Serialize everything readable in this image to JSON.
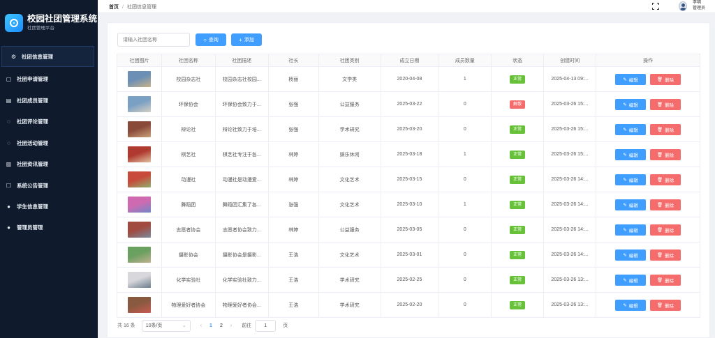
{
  "app": {
    "title": "校园社团管理系统",
    "subtitle": "社团管理平台"
  },
  "sidebar": {
    "items": [
      {
        "label": "社团信息管理",
        "icon": "gear-icon",
        "active": true
      },
      {
        "label": "社团申请管理",
        "icon": "document-icon"
      },
      {
        "label": "社团成员管理",
        "icon": "notebook-icon"
      },
      {
        "label": "社团评论管理",
        "icon": "chat-bubble-icon"
      },
      {
        "label": "社团活动管理",
        "icon": "chat-bubble-icon"
      },
      {
        "label": "社团资讯管理",
        "icon": "tickets-icon"
      },
      {
        "label": "系统公告管理",
        "icon": "edit-note-icon"
      },
      {
        "label": "学生信息管理",
        "icon": "user-icon"
      },
      {
        "label": "管理员管理",
        "icon": "user-icon"
      }
    ]
  },
  "header": {
    "breadcrumb_home": "首页",
    "breadcrumb_sep": "/",
    "breadcrumb_current": "社团信息管理",
    "user_name": "李明",
    "user_role": "管理员"
  },
  "toolbar": {
    "search_placeholder": "请输入社团名称",
    "search_label": "查询",
    "add_label": "添加"
  },
  "table": {
    "columns": [
      "社团图片",
      "社团名称",
      "社团描述",
      "社长",
      "社团类别",
      "成立日期",
      "成员数量",
      "状态",
      "创建时间",
      "操作"
    ],
    "edit_label": "编辑",
    "delete_label": "删除",
    "rows": [
      {
        "name": "校园杂志社",
        "desc": "校园杂志社校园...",
        "leader": "杨丽",
        "category": "文学类",
        "date": "2020-04-08",
        "members": "1",
        "status": "正常",
        "status_color": "#67c23a",
        "created": "2025-04-13 09:...",
        "img": [
          "#6b8fb5",
          "#c9b28a"
        ]
      },
      {
        "name": "环保协会",
        "desc": "环保协会致力于...",
        "leader": "张强",
        "category": "公益服务",
        "date": "2025-03-22",
        "members": "0",
        "status": "解散",
        "status_color": "#f56c6c",
        "created": "2025-03-26 15:...",
        "img": [
          "#7aa0c4",
          "#d4d0c4"
        ]
      },
      {
        "name": "辩论社",
        "desc": "辩论社致力于培...",
        "leader": "张强",
        "category": "学术研究",
        "date": "2025-03-20",
        "members": "0",
        "status": "正常",
        "status_color": "#67c23a",
        "created": "2025-03-26 15:...",
        "img": [
          "#8a4a3a",
          "#caa27a"
        ]
      },
      {
        "name": "棋艺社",
        "desc": "棋艺社专注于各...",
        "leader": "林婷",
        "category": "娱乐休闲",
        "date": "2025-03-18",
        "members": "1",
        "status": "正常",
        "status_color": "#67c23a",
        "created": "2025-03-26 15:...",
        "img": [
          "#b03a30",
          "#e0c0a0"
        ]
      },
      {
        "name": "动漫社",
        "desc": "动漫社是动漫爱...",
        "leader": "林婷",
        "category": "文化艺术",
        "date": "2025-03-15",
        "members": "0",
        "status": "正常",
        "status_color": "#67c23a",
        "created": "2025-03-26 14:...",
        "img": [
          "#c84a3a",
          "#8fb070"
        ]
      },
      {
        "name": "舞蹈团",
        "desc": "舞蹈团汇集了各...",
        "leader": "张强",
        "category": "文化艺术",
        "date": "2025-03-10",
        "members": "1",
        "status": "正常",
        "status_color": "#67c23a",
        "created": "2025-03-26 14:...",
        "img": [
          "#d06ab0",
          "#7088c8"
        ]
      },
      {
        "name": "志愿者协会",
        "desc": "志愿者协会致力...",
        "leader": "林婷",
        "category": "公益服务",
        "date": "2025-03-05",
        "members": "0",
        "status": "正常",
        "status_color": "#67c23a",
        "created": "2025-03-26 14:...",
        "img": [
          "#a04a40",
          "#7a8a9a"
        ]
      },
      {
        "name": "摄影协会",
        "desc": "摄影协会是摄影...",
        "leader": "王浩",
        "category": "文化艺术",
        "date": "2025-03-01",
        "members": "0",
        "status": "正常",
        "status_color": "#67c23a",
        "created": "2025-03-26 14:...",
        "img": [
          "#6aa060",
          "#c0b090"
        ]
      },
      {
        "name": "化学实验社",
        "desc": "化学实验社致力...",
        "leader": "王浩",
        "category": "学术研究",
        "date": "2025-02-25",
        "members": "0",
        "status": "正常",
        "status_color": "#67c23a",
        "created": "2025-03-26 13:...",
        "img": [
          "#d8d8dc",
          "#6a7a8a"
        ]
      },
      {
        "name": "物理爱好者协会",
        "desc": "物理爱好者协会...",
        "leader": "王浩",
        "category": "学术研究",
        "date": "2025-02-20",
        "members": "0",
        "status": "正常",
        "status_color": "#67c23a",
        "created": "2025-03-26 13:...",
        "img": [
          "#8a5a40",
          "#c85a50"
        ]
      }
    ]
  },
  "pagination": {
    "total_text": "共 16 条",
    "page_size": "10条/页",
    "prev_arrow": "‹",
    "next_arrow": "›",
    "pages": [
      "1",
      "2"
    ],
    "current_page": "1",
    "goto_label": "前往",
    "goto_value": "1",
    "page_unit": "页"
  }
}
